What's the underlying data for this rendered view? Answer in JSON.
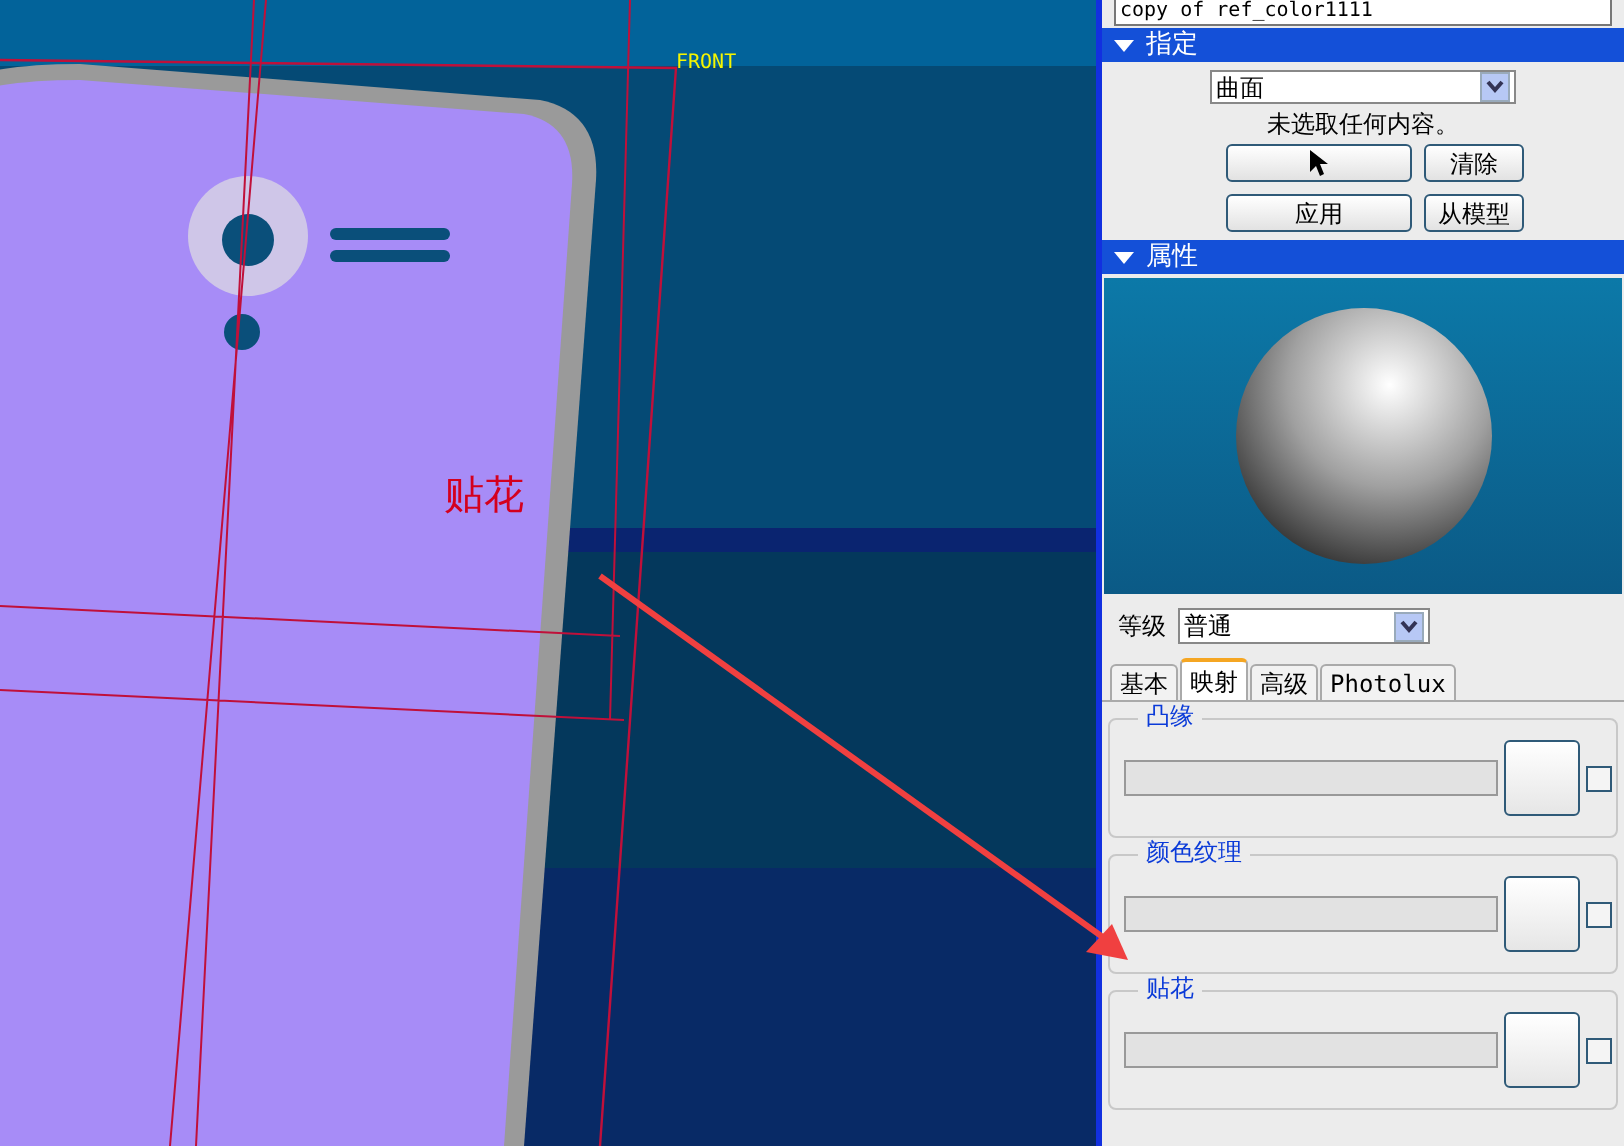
{
  "viewport": {
    "datum_label": "FRONT",
    "annotation_text": "贴花"
  },
  "panel": {
    "top_field": "copy of ref_color1111",
    "sections": [
      {
        "title": "指定",
        "expanded": true
      },
      {
        "title": "属性",
        "expanded": true
      }
    ],
    "geometry_select": "曲面",
    "status": "未选取任何内容。",
    "buttons": [
      {
        "kind": "pointer"
      },
      {
        "kind": "text",
        "label": "清除"
      },
      {
        "kind": "text",
        "label": "应用"
      },
      {
        "kind": "text",
        "label": "从模型"
      }
    ],
    "level_label": "等级",
    "level_select": "普通",
    "tabs": [
      {
        "label": "基本",
        "selected": false
      },
      {
        "label": "映射",
        "selected": true
      },
      {
        "label": "高级",
        "selected": false
      },
      {
        "label": "Photolux",
        "selected": false
      }
    ],
    "groups": [
      {
        "title": "凸缘",
        "checked": false
      },
      {
        "title": "颜色纹理",
        "checked": false
      },
      {
        "title": "贴花",
        "checked": false
      }
    ]
  }
}
